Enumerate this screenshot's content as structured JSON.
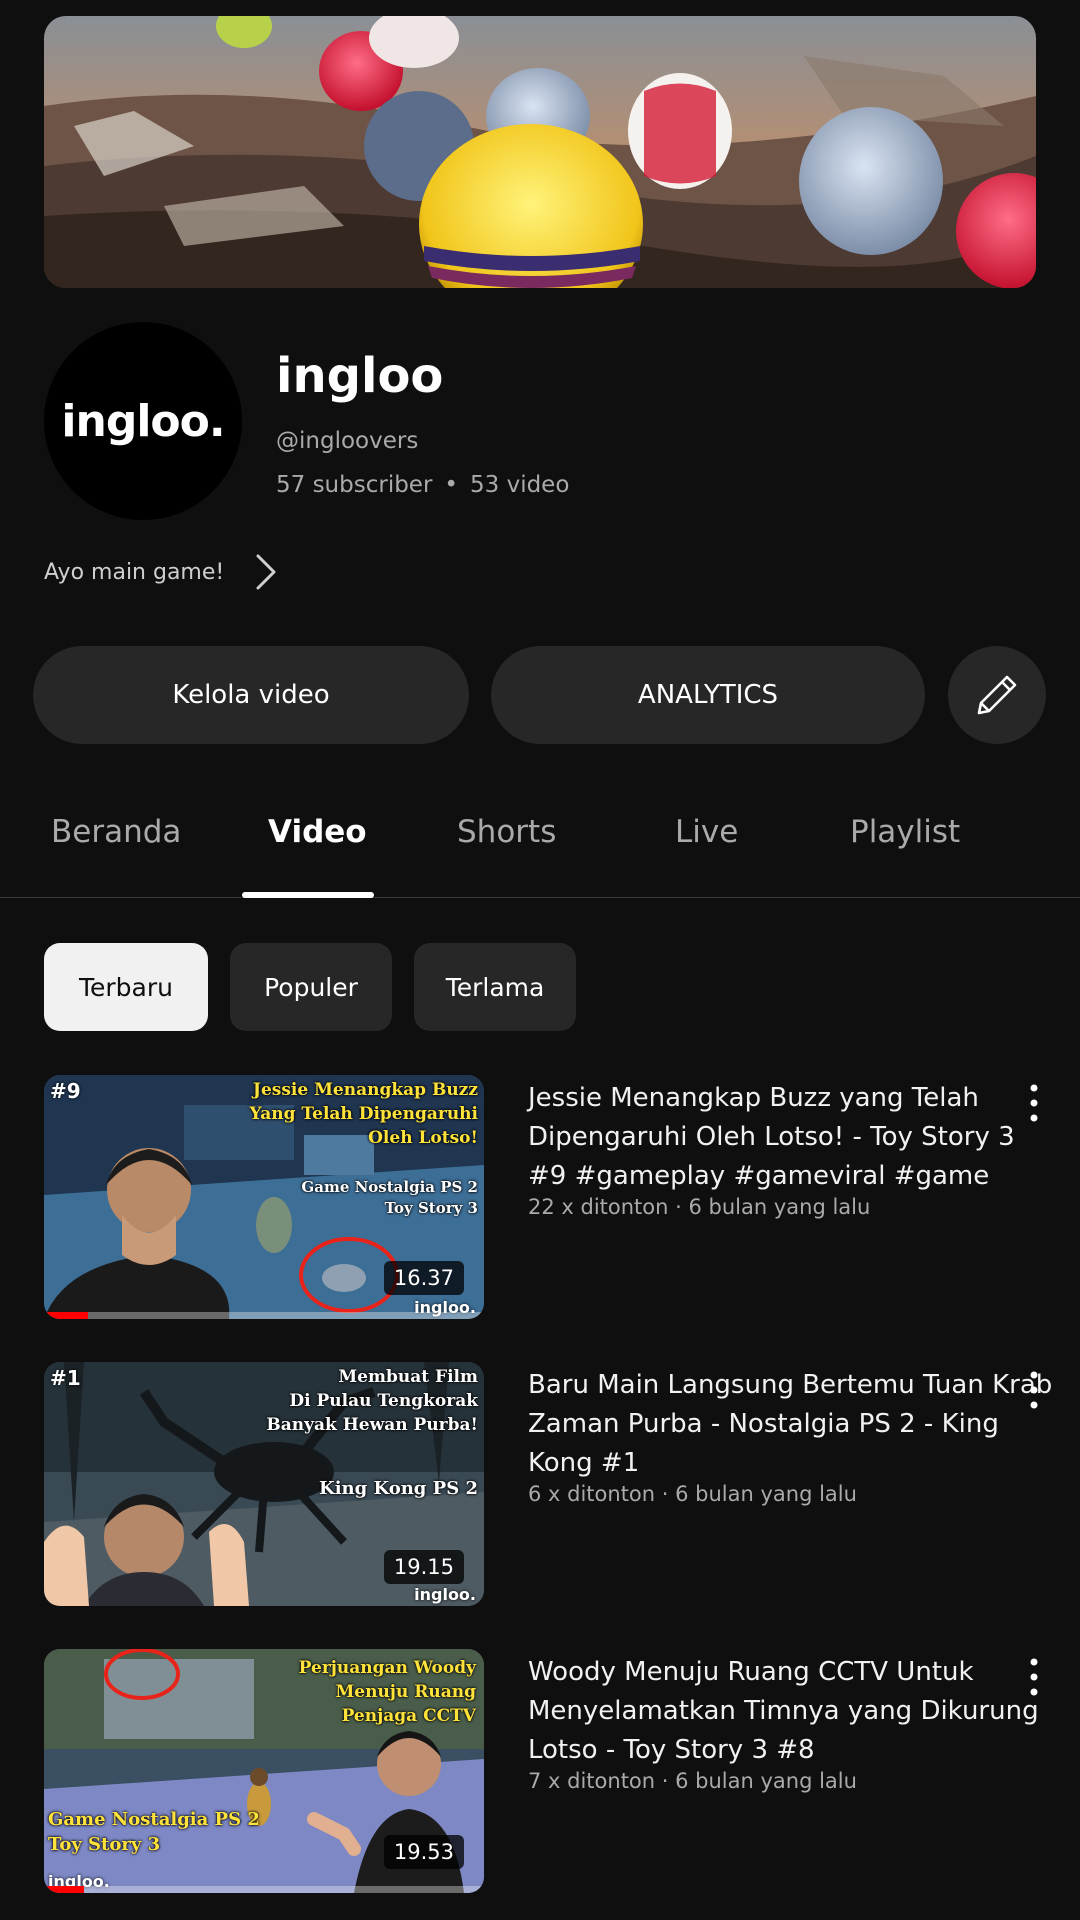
{
  "channel": {
    "name": "ingloo",
    "avatar_text": "ingloo.",
    "handle": "@ingloovers",
    "subscribers": "57 subscriber",
    "video_count": "53 video",
    "description": "Ayo main game!"
  },
  "actions": {
    "manage_label": "Kelola video",
    "analytics_label": "ANALYTICS",
    "edit_icon": "pencil-icon"
  },
  "tabs": [
    {
      "label": "Beranda",
      "active": false
    },
    {
      "label": "Video",
      "active": true
    },
    {
      "label": "Shorts",
      "active": false
    },
    {
      "label": "Live",
      "active": false
    },
    {
      "label": "Playlist",
      "active": false
    }
  ],
  "chips": [
    {
      "label": "Terbaru",
      "active": true
    },
    {
      "label": "Populer",
      "active": false
    },
    {
      "label": "Terlama",
      "active": false
    }
  ],
  "videos": [
    {
      "title": "Jessie Menangkap Buzz yang Telah Dipengaruhi Oleh Lotso! - Toy Story 3 #9 #gameplay #gameviral #game",
      "meta": "22 x ditonton · 6 bulan yang lalu",
      "duration": "16.37",
      "thumb_episode": "#9",
      "thumb_caption_lines": [
        "Jessie Menangkap Buzz",
        "Yang Telah Dipengaruhi",
        "Oleh Lotso!"
      ],
      "thumb_game_lines": [
        "Game Nostalgia PS 2",
        "Toy Story 3"
      ],
      "thumb_brand": "ingloo.",
      "progress": 0.1
    },
    {
      "title": "Baru Main Langsung Bertemu Tuan Krab Zaman Purba - Nostalgia PS 2 - King Kong #1",
      "meta": "6 x ditonton · 6 bulan yang lalu",
      "duration": "19.15",
      "thumb_episode": "#1",
      "thumb_caption_lines": [
        "Membuat Film",
        "Di Pulau Tengkorak",
        "Banyak Hewan Purba!"
      ],
      "thumb_game_lines": [
        "King Kong PS 2"
      ],
      "thumb_brand": "ingloo.",
      "progress": 0
    },
    {
      "title": "Woody Menuju Ruang CCTV Untuk Menyelamatkan Timnya yang Dikurung Lotso - Toy Story 3 #8",
      "meta": "7 x ditonton · 6 bulan yang lalu",
      "duration": "19.53",
      "thumb_episode": "",
      "thumb_caption_lines": [
        "Perjuangan Woody",
        "Menuju Ruang",
        "Penjaga CCTV"
      ],
      "thumb_game_lines": [
        "Game Nostalgia PS 2",
        "Toy Story 3"
      ],
      "thumb_brand": "ingloo.",
      "progress": 0.09
    }
  ],
  "colors": {
    "background": "#0f0f0f",
    "button": "#272727",
    "chip_active": "#f1f1f1",
    "progress": "#ff0000",
    "thumb_caption_yellow": "#ffe23a"
  }
}
